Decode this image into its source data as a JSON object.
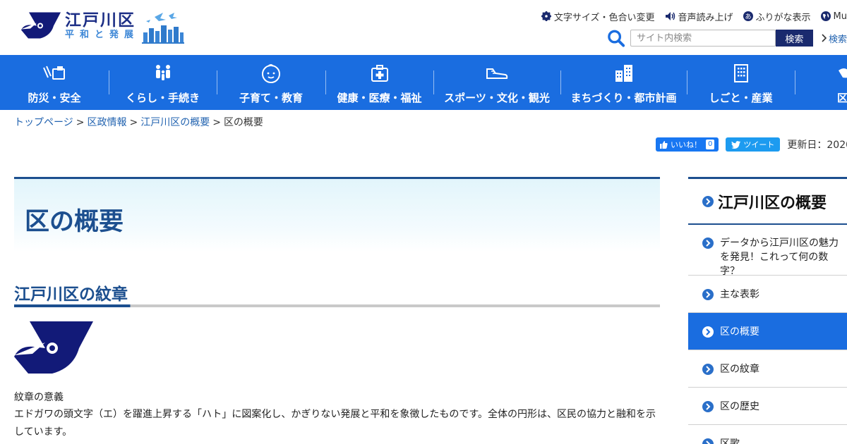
{
  "header": {
    "logo_title": "江戸川区",
    "logo_subtitle": "平和と発展",
    "utility": [
      {
        "label": "文字サイズ・色合い変更",
        "icon": "gear-icon"
      },
      {
        "label": "音声読み上げ",
        "icon": "speaker-icon"
      },
      {
        "label": "ふりがな表示",
        "icon": "furigana-icon"
      },
      {
        "label": "Mu",
        "icon": "globe-icon"
      }
    ],
    "search": {
      "placeholder": "サイト内検索",
      "button_label": "検索",
      "advanced_label": "検索"
    }
  },
  "nav": [
    {
      "label": "防災・安全",
      "icon": "disaster-safety-icon"
    },
    {
      "label": "くらし・手続き",
      "icon": "people-icon"
    },
    {
      "label": "子育て・教育",
      "icon": "baby-icon"
    },
    {
      "label": "健康・医療・福祉",
      "icon": "medical-kit-icon"
    },
    {
      "label": "スポーツ・文化・観光",
      "icon": "sneaker-icon"
    },
    {
      "label": "まちづくり・都市計画",
      "icon": "city-icon"
    },
    {
      "label": "しごと・産業",
      "icon": "building-icon"
    },
    {
      "label": "区政",
      "icon": "dove-icon"
    }
  ],
  "breadcrumb": {
    "items": [
      "トップページ",
      "区政情報",
      "江戸川区の概要"
    ],
    "current": "区の概要",
    "separator": ">"
  },
  "social": {
    "like_label": "いいね！",
    "like_count": "0",
    "tweet_label": "ツイート",
    "updated": "更新日：2020"
  },
  "main": {
    "title": "区の概要",
    "section_heading": "江戸川区の紋章",
    "emblem_caption": "紋章の意義",
    "emblem_description": "エドガワの頭文字（エ）を躍進上昇する「ハト」に図案化し、かぎりない発展と平和を象徴したものです。全体の円形は、区民の協力と融和を示しています。"
  },
  "sidebar": {
    "title": "江戸川区の概要",
    "items": [
      {
        "label": "データから江戸川区の魅力を発見！これって何の数字？",
        "active": false
      },
      {
        "label": "主な表彰",
        "active": false
      },
      {
        "label": "区の概要",
        "active": true
      },
      {
        "label": "区の紋章",
        "active": false
      },
      {
        "label": "区の歴史",
        "active": false
      },
      {
        "label": "区歌",
        "active": false
      }
    ]
  },
  "colors": {
    "nav_blue": "#1a6de0",
    "navy": "#1d2f86",
    "heading": "#1c4f8f",
    "link": "#2263b0"
  }
}
